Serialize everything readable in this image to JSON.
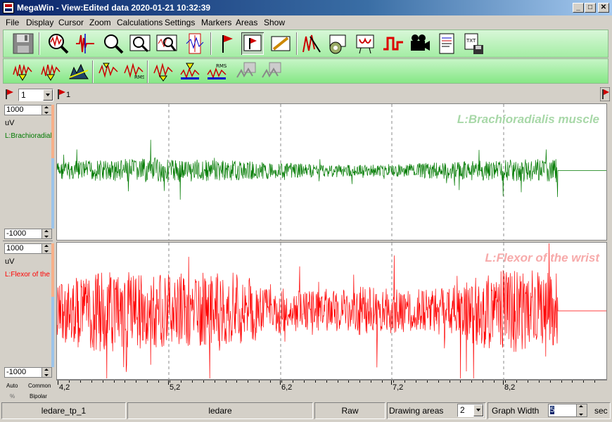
{
  "window": {
    "app": "MegaWin",
    "title": "MegaWin - View:Edited data 2020-01-21 10:32:39",
    "controls": {
      "minimize": "_",
      "maximize": "□",
      "close": "✕"
    }
  },
  "menu": [
    "File",
    "Display",
    "Cursor",
    "Zoom",
    "Calculations",
    "Settings",
    "Markers",
    "Areas",
    "Show"
  ],
  "toolbar1": [
    "save-icon",
    "zoom-signal-icon",
    "spike-icon",
    "magnifier-icon",
    "zoom-rect-icon",
    "zoom-wave-icon",
    "amplitude-scale-icon",
    "flag-marker-icon",
    "display-marker-icon",
    "edit-area-icon",
    "cut-signal-icon",
    "settings-chip-icon",
    "print-preview-icon",
    "pulse-icon",
    "camera-icon",
    "report-icon",
    "txt-export-icon"
  ],
  "toolbar2": [
    "emg-analysis-1-icon",
    "emg-analysis-2-icon",
    "frequency-icon",
    "rms-1-icon",
    "rms-2-icon",
    "rms-3-icon",
    "area-avg-icon",
    "rms-4-icon",
    "cursor-table-1-icon",
    "cursor-table-2-icon"
  ],
  "markers": {
    "combo_value": "1",
    "marker_label": "1"
  },
  "channels": [
    {
      "max": "1000",
      "unit": "uV",
      "name": "L:Brachioradialis muscle",
      "short_name": "L:Brachioradialis",
      "min": "-1000",
      "color": "#007a00",
      "label_color": "#a8d8a8"
    },
    {
      "max": "1000",
      "unit": "uV",
      "name": "L:Flexor of the wrist",
      "short_name": "L:Flexor of the",
      "min": "-1000",
      "color": "#ff0000",
      "label_color": "#f7aaaa"
    }
  ],
  "axis": {
    "ticks": [
      "4,2",
      "5,2",
      "6,2",
      "7,2",
      "8,2"
    ]
  },
  "mode": {
    "auto": "Auto",
    "common": "Common",
    "bipolar": "Bipolar",
    "percent": "%"
  },
  "status": {
    "file": "ledare_tp_1",
    "subject": "ledare",
    "data_type": "Raw",
    "drawing_areas_label": "Drawing areas",
    "drawing_areas_value": "2",
    "graph_width_label": "Graph Width",
    "graph_width_value": "5",
    "graph_width_unit": "sec"
  }
}
